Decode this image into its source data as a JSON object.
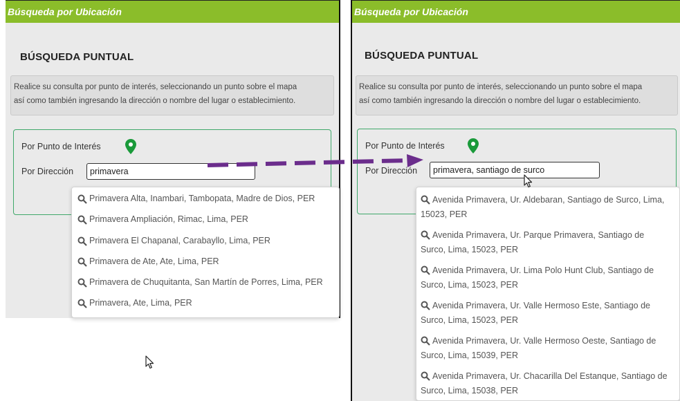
{
  "left": {
    "header": "Búsqueda por Ubicación",
    "section_title": "BÚSQUEDA PUNTUAL",
    "info_line1": "Realice su consulta por punto de interés, seleccionando un punto sobre el mapa",
    "info_line2": "así como también ingresando la dirección o nombre del lugar o establecimiento.",
    "poi_label": "Por Punto de Interés",
    "address_label": "Por Dirección",
    "address_value": "primavera",
    "suggestions": [
      "Primavera Alta, Inambari, Tambopata, Madre de Dios, PER",
      "Primavera Ampliación, Rimac, Lima, PER",
      "Primavera El Chapanal, Carabayllo, Lima, PER",
      "Primavera de Ate, Ate, Lima, PER",
      "Primavera de Chuquitanta, San Martín de Porres, Lima, PER",
      "Primavera, Ate, Lima, PER"
    ]
  },
  "right": {
    "header": "Búsqueda por Ubicación",
    "section_title": "BÚSQUEDA PUNTUAL",
    "info_line1": "Realice su consulta por punto de interés, seleccionando un punto sobre el mapa",
    "info_line2": "así como también ingresando la dirección o nombre del lugar o establecimiento.",
    "poi_label": "Por Punto de Interés",
    "address_label": "Por Dirección",
    "address_value": "primavera, santiago de surco",
    "suggestions": [
      [
        "Avenida Primavera, Ur. Aldebaran, Santiago de Surco, Lima,",
        "15023, PER"
      ],
      [
        "Avenida Primavera, Ur. Parque Primavera, Santiago de",
        "Surco, Lima, 15023, PER"
      ],
      [
        "Avenida Primavera, Ur. Lima Polo Hunt Club, Santiago de",
        "Surco, Lima, 15023, PER"
      ],
      [
        "Avenida Primavera, Ur. Valle Hermoso Este, Santiago de",
        "Surco, Lima, 15023, PER"
      ],
      [
        "Avenida Primavera, Ur. Valle Hermoso Oeste, Santiago de",
        "Surco, Lima, 15039, PER"
      ],
      [
        "Avenida Primavera, Ur. Chacarilla Del Estanque, Santiago de",
        "Surco, Lima, 15038, PER"
      ]
    ]
  },
  "colors": {
    "header_green": "#8bbd2a",
    "card_border": "#3fa86a",
    "pin_green": "#1a9a3a",
    "arrow_purple": "#6b2d8c"
  }
}
